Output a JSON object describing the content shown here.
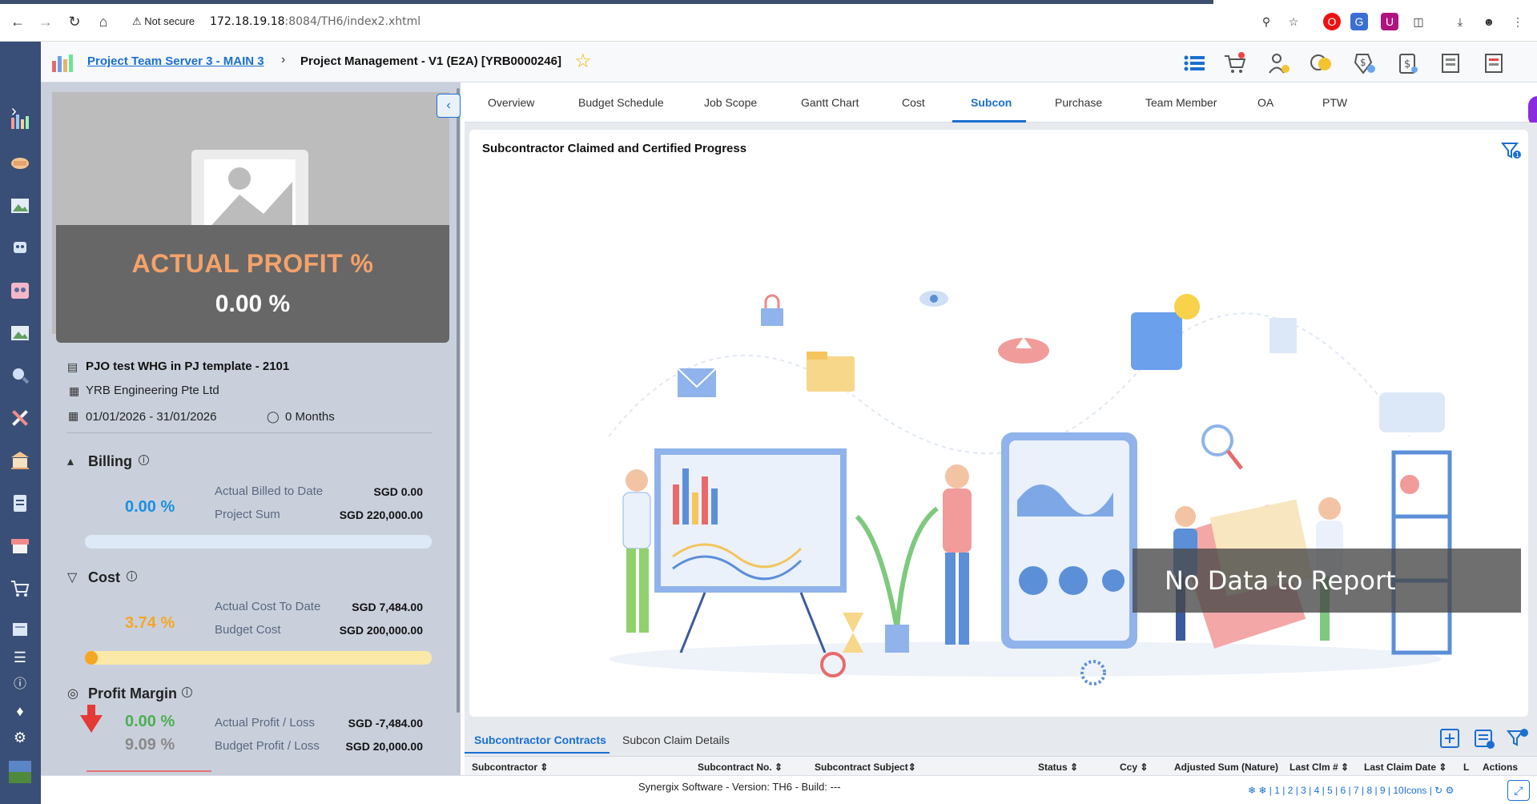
{
  "browser": {
    "security_label": "Not secure",
    "url_host": "172.18.19.18",
    "url_path": ":8084/TH6/index2.xhtml"
  },
  "header": {
    "server_link": "Project Team Server 3 - MAIN 3",
    "separator": "›",
    "project_title": "Project Management - V1 (E2A) [YRB0000246]"
  },
  "profit_card": {
    "title": "ACTUAL PROFIT %",
    "value": "0.00 %"
  },
  "project": {
    "name": "PJO test WHG in PJ template - 2101",
    "company": "YRB Engineering Pte Ltd",
    "dates": "01/01/2026 - 31/01/2026",
    "months": "0 Months"
  },
  "billing": {
    "title": "Billing",
    "percent": "0.00 %",
    "progress": 0.0,
    "rows": [
      {
        "label": "Actual Billed to Date",
        "value": "SGD 0.00"
      },
      {
        "label": "Project Sum",
        "value": "SGD 220,000.00"
      }
    ]
  },
  "cost": {
    "title": "Cost",
    "percent": "3.74 %",
    "progress": 0.0374,
    "rows": [
      {
        "label": "Actual Cost To Date",
        "value": "SGD 7,484.00"
      },
      {
        "label": "Budget Cost",
        "value": "SGD 200,000.00"
      }
    ]
  },
  "profit_margin": {
    "title": "Profit Margin",
    "actual_percent": "0.00 %",
    "budget_percent": "9.09 %",
    "rows": [
      {
        "label": "Actual Profit / Loss",
        "value": "SGD -7,484.00"
      },
      {
        "label": "Budget Profit / Loss",
        "value": "SGD 20,000.00"
      }
    ]
  },
  "tabs": [
    "Overview",
    "Budget Schedule",
    "Job Scope",
    "Gantt Chart",
    "Cost",
    "Subcon",
    "Purchase",
    "Team Member",
    "OA",
    "PTW"
  ],
  "active_tab": "Subcon",
  "chart": {
    "title": "Subcontractor Claimed and Certified Progress",
    "no_data": "No Data to Report",
    "filter_count": "1"
  },
  "subtabs": [
    "Subcontractor Contracts",
    "Subcon Claim Details"
  ],
  "grid_columns": [
    "Subcontractor",
    "Subcontract No.",
    "Subcontract Subject",
    "Status",
    "Ccy",
    "Adjusted Sum (Nature)",
    "Last Clm #",
    "Last Claim Date",
    "L",
    "Actions"
  ],
  "footer": {
    "text": "Synergix Software - Version: TH6 - Build: ---",
    "links": "| 1 | 2 | 3 | 4 | 5 | 6 | 7 | 8 | 9 | 10Icons |"
  },
  "colors": {
    "rail": "#3a4f77",
    "accent": "#1a6fd1",
    "profit_title": "#f4a26a",
    "billing_pct": "#1a8fe0",
    "cost_pct": "#f5a623",
    "margin_pct": "#4caf50"
  }
}
